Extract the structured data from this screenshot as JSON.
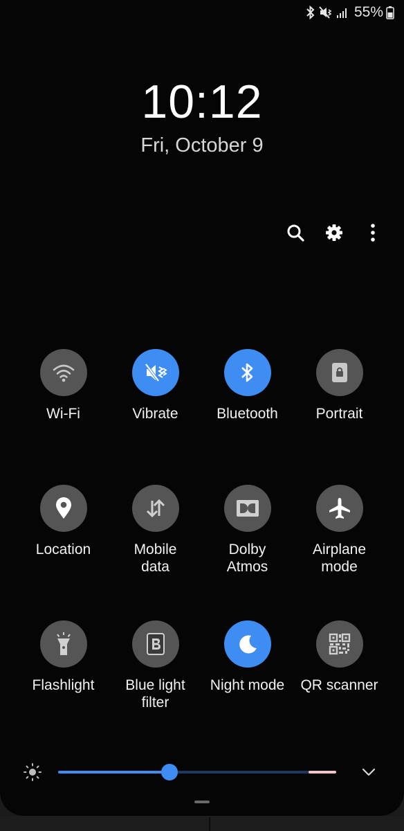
{
  "status_bar": {
    "icons": [
      "bluetooth-icon",
      "vibrate-icon",
      "signal-icon",
      "battery-icon"
    ],
    "battery_percent": "55%"
  },
  "lockscreen": {
    "time": "10:12",
    "date": "Fri, October 9"
  },
  "header_actions": [
    "search-icon",
    "gear-icon",
    "more-vert-icon"
  ],
  "tiles": [
    {
      "label": "Wi-Fi",
      "icon": "wifi-icon",
      "on": false
    },
    {
      "label": "Vibrate",
      "icon": "vibrate-icon",
      "on": true
    },
    {
      "label": "Bluetooth",
      "icon": "bluetooth-icon",
      "on": true
    },
    {
      "label": "Portrait",
      "icon": "portrait-lock-icon",
      "on": false
    },
    {
      "label": "Location",
      "icon": "location-pin-icon",
      "on": false
    },
    {
      "label": "Mobile\ndata",
      "icon": "mobile-data-icon",
      "on": false
    },
    {
      "label": "Dolby\nAtmos",
      "icon": "dolby-icon",
      "on": false
    },
    {
      "label": "Airplane\nmode",
      "icon": "airplane-icon",
      "on": false
    },
    {
      "label": "Flashlight",
      "icon": "flashlight-icon",
      "on": false
    },
    {
      "label": "Blue light\nfilter",
      "icon": "blue-light-filter-icon",
      "on": false
    },
    {
      "label": "Night mode",
      "icon": "moon-icon",
      "on": true
    },
    {
      "label": "QR scanner",
      "icon": "qr-code-icon",
      "on": false
    }
  ],
  "brightness": {
    "level_fraction": 0.4,
    "icon": "sun-icon"
  },
  "colors": {
    "accent": "#3e8df3",
    "tile_off": "#555555",
    "background": "#050505"
  }
}
